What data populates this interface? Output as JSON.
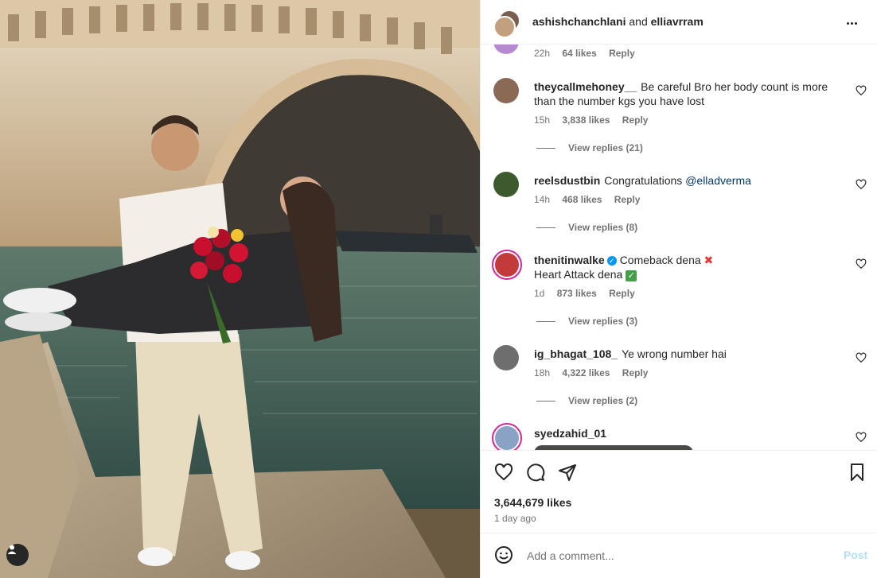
{
  "post": {
    "header": {
      "user1": "ashishchanchlani",
      "connector": "and",
      "user2": "elliavrram",
      "more_icon": "more-horizontal-icon"
    },
    "tag_icon": "user-tag-icon"
  },
  "comments": [
    {
      "username": "",
      "text": "",
      "time": "22h",
      "likes": "64 likes",
      "reply": "Reply"
    },
    {
      "username": "theycallmehoney__",
      "text": "Be careful Bro her body count is more than the number kgs you have lost",
      "time": "15h",
      "likes": "3,838 likes",
      "reply": "Reply",
      "view_replies": "View replies (21)"
    },
    {
      "username": "reelsdustbin",
      "text": "Congratulations ",
      "mention": "@elladverma",
      "time": "14h",
      "likes": "468 likes",
      "reply": "Reply",
      "view_replies": "View replies (8)"
    },
    {
      "username": "thenitinwalke",
      "verified": "✓",
      "text": "Comeback dena",
      "text_line2": "Heart Attack dena",
      "emoji1": "✖",
      "emoji2": "✓",
      "time": "1d",
      "likes": "873 likes",
      "reply": "Reply",
      "view_replies": "View replies (3)"
    },
    {
      "username": "ig_bhagat_108_",
      "text": "Ye wrong number hai",
      "time": "18h",
      "likes": "4,322 likes",
      "reply": "Reply",
      "view_replies": "View replies (2)"
    },
    {
      "username": "syedzahid_01",
      "text": ""
    }
  ],
  "actions": {
    "like_icon": "heart-icon",
    "comment_icon": "comment-icon",
    "share_icon": "share-icon",
    "save_icon": "bookmark-icon",
    "likes": "3,644,679 likes",
    "time_ago": "1 day ago"
  },
  "add_comment": {
    "emoji_icon": "emoji-icon",
    "placeholder": "Add a comment...",
    "post_label": "Post",
    "post_color": "#b2dffc"
  },
  "colors": {
    "text": "#262626",
    "muted": "#737373",
    "mention": "#00376b",
    "verified": "#0095f6"
  }
}
